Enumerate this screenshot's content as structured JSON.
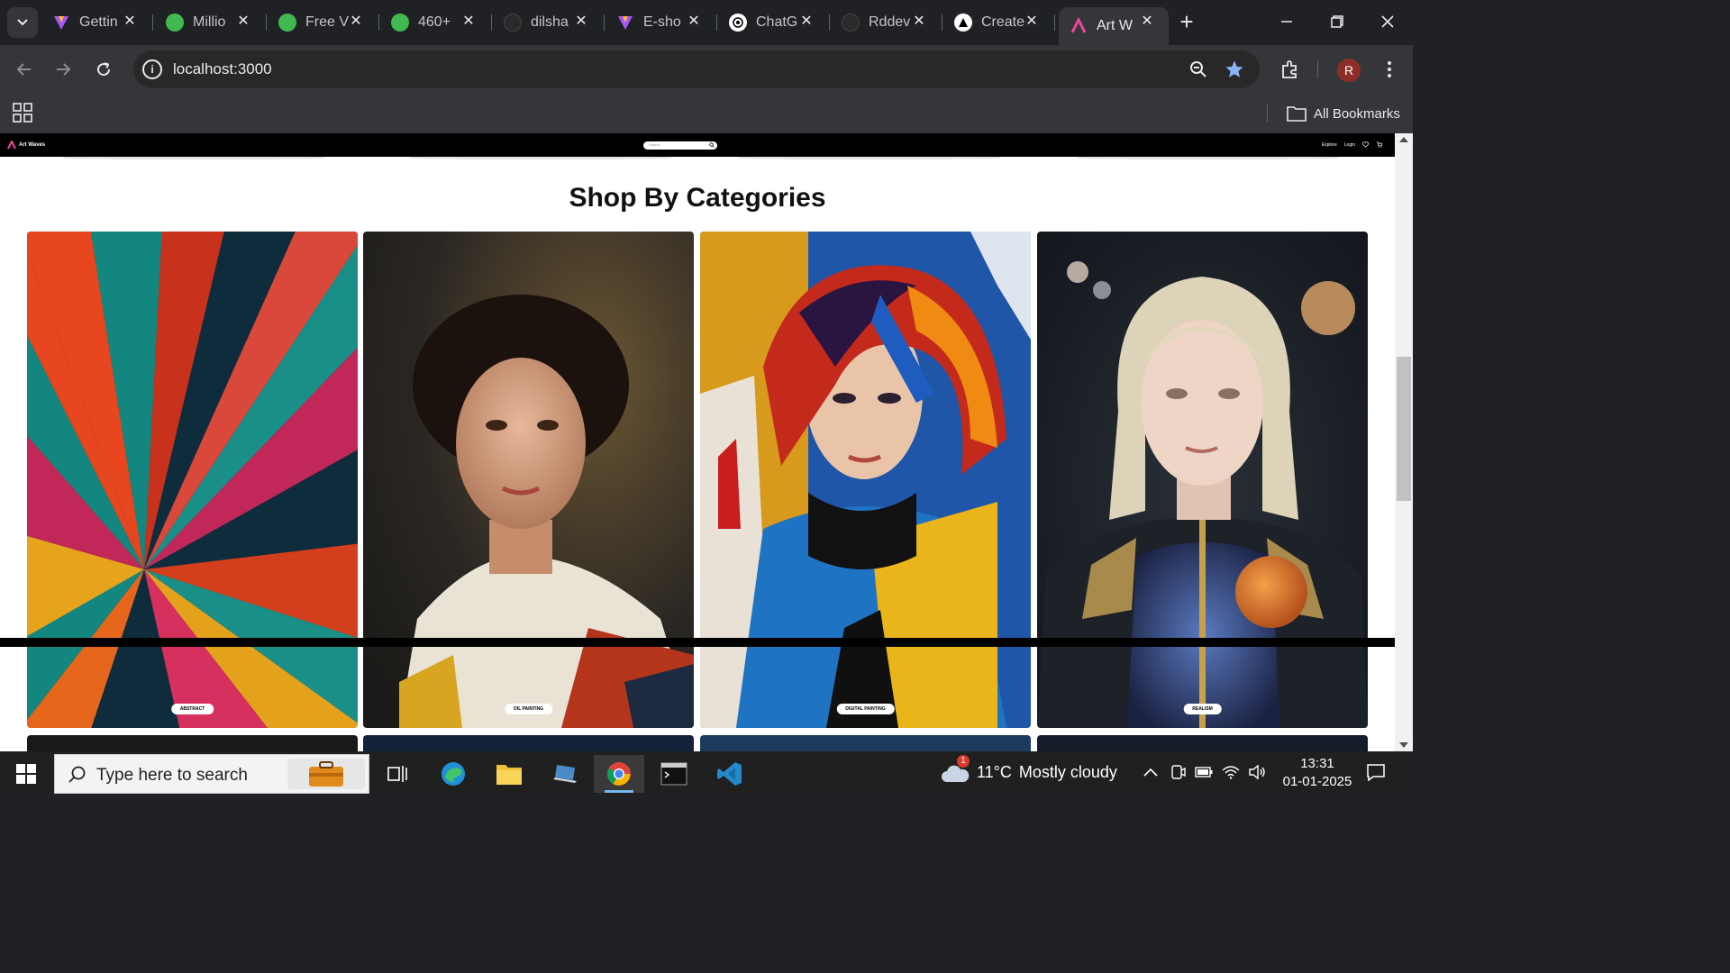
{
  "browser": {
    "tabs": [
      {
        "title": "Gettin",
        "favicon": "vite-icon"
      },
      {
        "title": "Millio",
        "favicon": "green-icon"
      },
      {
        "title": "Free V",
        "favicon": "green-icon"
      },
      {
        "title": "460+",
        "favicon": "green-icon"
      },
      {
        "title": "dilsha",
        "favicon": "github-icon"
      },
      {
        "title": "E-sho",
        "favicon": "vite-icon"
      },
      {
        "title": "ChatG",
        "favicon": "chatgpt-icon"
      },
      {
        "title": "Rddev",
        "favicon": "github-icon"
      },
      {
        "title": "Create",
        "favicon": "vercel-icon"
      },
      {
        "title": "Art W",
        "favicon": "artwaves-icon",
        "active": true
      }
    ],
    "url": "localhost:3000",
    "avatar_initial": "R",
    "bookmarks_label": "All Bookmarks"
  },
  "site": {
    "logo_text": "Art Waves",
    "search_placeholder": "Search",
    "nav_links": [
      "Explore",
      "Login"
    ],
    "section_title": "Shop By Categories",
    "categories": [
      {
        "label": "ABSTRACT"
      },
      {
        "label": "OIL PAINTING"
      },
      {
        "label": "DIGITAL PAINTING"
      },
      {
        "label": "REALISM"
      }
    ]
  },
  "taskbar": {
    "search_placeholder": "Type here to search",
    "weather_temp": "11°C",
    "weather_desc": "Mostly cloudy",
    "weather_badge": "1",
    "time": "13:31",
    "date": "01-01-2025"
  }
}
